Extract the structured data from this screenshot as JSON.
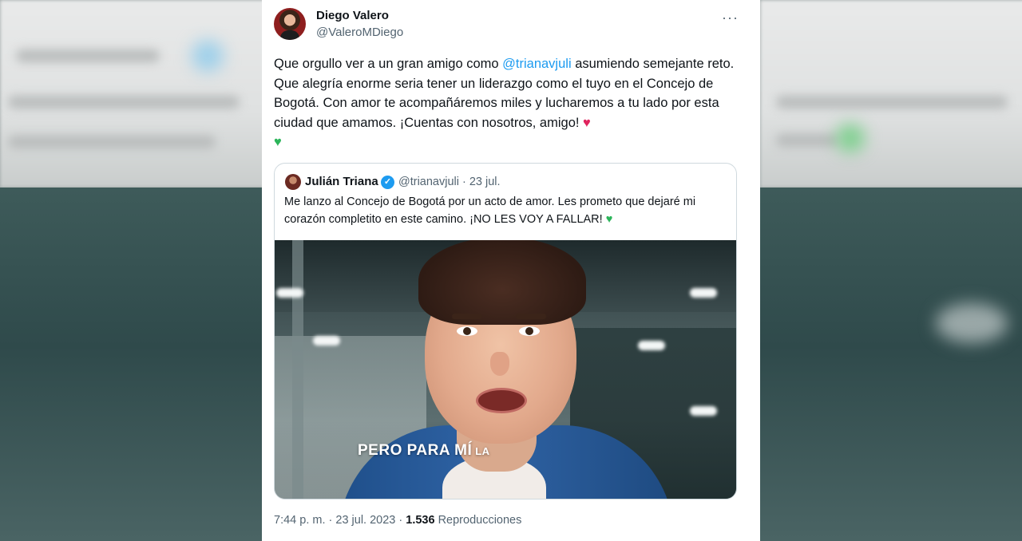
{
  "tweet": {
    "author_name": "Diego Valero",
    "author_handle": "@ValeroMDiego",
    "more_icon": "···",
    "text_before_mention": "Que orgullo ver a un gran amigo como ",
    "mention": "@trianavjuli",
    "text_after_mention": " asumiendo semejante reto. Que alegría enorme seria tener un liderazgo como el tuyo en el Concejo de Bogotá. Con amor te acompañáremos miles y lucharemos a tu lado por esta ciudad que amamos. ¡Cuentas con nosotros, amigo! ",
    "emoji_red_heart": "♥",
    "emoji_green_heart": "♥",
    "time": "7:44 p. m.",
    "date": "23 jul. 2023",
    "views_count": "1.536",
    "views_label": "Reproducciones"
  },
  "quoted": {
    "author_name": "Julián Triana",
    "verified_glyph": "✓",
    "handle_date": "@trianavjuli · 23 jul.",
    "text": "Me lanzo al Concejo de Bogotá por un acto de amor. Les prometo que dejaré mi corazón completito en este camino. ¡NO LES VOY A FALLAR! ",
    "emoji_green_heart": "♥",
    "video_caption_big": "PERO PARA MÍ",
    "video_caption_small": "LA"
  },
  "colors": {
    "link": "#1d9bf0",
    "heart_red": "#e0245e",
    "heart_green": "#2cb55a",
    "secondary_text": "#536471"
  }
}
